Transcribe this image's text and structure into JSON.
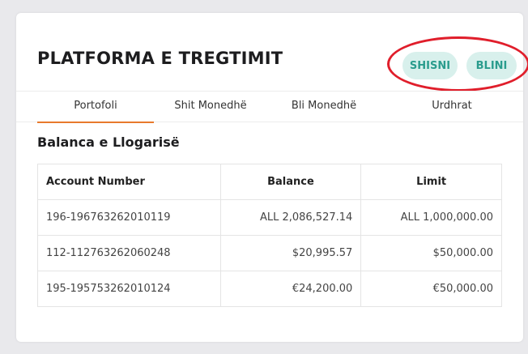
{
  "header": {
    "title": "PLATFORMA E TREGTIMIT",
    "sell_label": "SHISNI",
    "buy_label": "BLINI"
  },
  "tabs": [
    {
      "label": "Portofoli",
      "active": true
    },
    {
      "label": "Shit Monedhë",
      "active": false
    },
    {
      "label": "Bli Monedhë",
      "active": false
    },
    {
      "label": "Urdhrat",
      "active": false
    }
  ],
  "section": {
    "title": "Balanca e Llogarisë"
  },
  "table": {
    "headers": [
      "Account Number",
      "Balance",
      "Limit"
    ],
    "rows": [
      {
        "account": "196-196763262010119",
        "balance": "ALL 2,086,527.14",
        "limit": "ALL 1,000,000.00"
      },
      {
        "account": "112-112763262060248",
        "balance": "$20,995.57",
        "limit": "$50,000.00"
      },
      {
        "account": "195-195753262010124",
        "balance": "€24,200.00",
        "limit": "€50,000.00"
      }
    ]
  },
  "colors": {
    "accent_tab": "#e87a2d",
    "button_bg": "#d8f0ec",
    "button_text": "#2a9c8d",
    "annotation": "#e01e2b"
  }
}
